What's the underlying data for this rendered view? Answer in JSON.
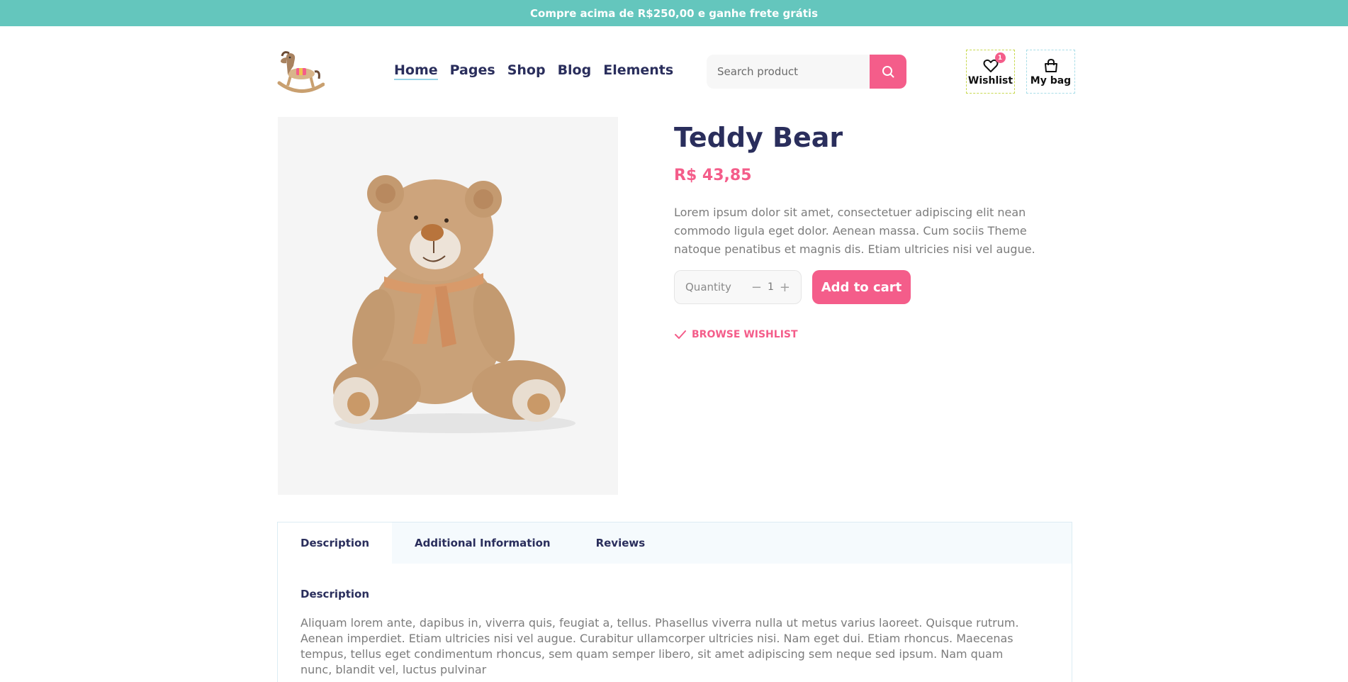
{
  "promo": {
    "text": "Compre acima de R$250,00 e ganhe frete grátis"
  },
  "nav": {
    "items": [
      {
        "label": "Home"
      },
      {
        "label": "Pages"
      },
      {
        "label": "Shop"
      },
      {
        "label": "Blog"
      },
      {
        "label": "Elements"
      }
    ]
  },
  "search": {
    "placeholder": "Search product"
  },
  "header_buttons": {
    "wishlist_label": "Wishlist",
    "wishlist_count": "1",
    "bag_label": "My bag"
  },
  "product": {
    "title": "Teddy Bear",
    "price": "R$ 43,85",
    "description": "Lorem ipsum dolor sit amet, consectetuer adipiscing elit nean commodo ligula eget dolor. Aenean massa. Cum sociis Theme natoque penatibus et magnis dis. Etiam ultricies nisi vel augue.",
    "quantity_label": "Quantity",
    "quantity_value": "1",
    "add_to_cart": "Add to cart",
    "browse_wishlist": "BROWSE WISHLIST"
  },
  "tabs": {
    "items": [
      {
        "label": "Description"
      },
      {
        "label": "Additional Information"
      },
      {
        "label": "Reviews"
      }
    ],
    "content_title": "Description",
    "content_text": "Aliquam lorem ante, dapibus in, viverra quis, feugiat a, tellus. Phasellus viverra nulla ut metus varius laoreet. Quisque rutrum. Aenean imperdiet. Etiam ultricies nisi vel augue. Curabitur ullamcorper ultricies nisi. Nam eget dui. Etiam rhoncus. Maecenas tempus, tellus eget condimentum rhoncus, sem quam semper libero, sit amet adipiscing sem neque sed ipsum. Nam quam nunc, blandit vel, luctus pulvinar"
  },
  "colors": {
    "promo_bg": "#64c6bd",
    "accent": "#f45d8a",
    "heading": "#2a2e5c"
  },
  "icons": {
    "logo": "rocking-horse-logo",
    "search": "search-icon",
    "wishlist": "heart-icon",
    "bag": "shopping-bag-icon",
    "check": "check-icon",
    "minus": "minus-icon",
    "plus": "plus-icon"
  }
}
